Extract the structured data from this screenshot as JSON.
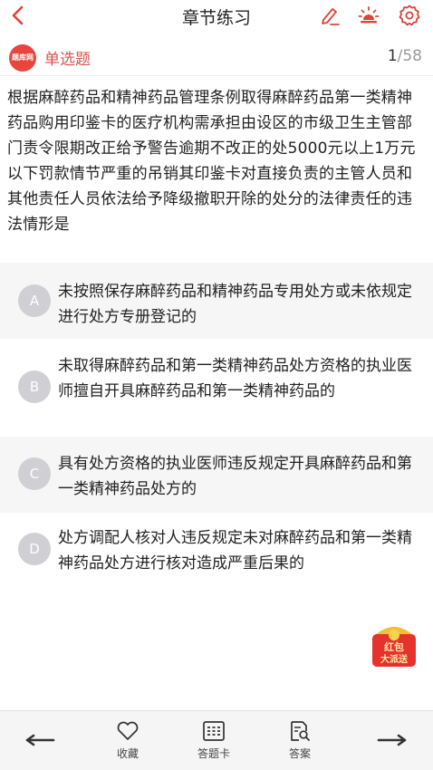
{
  "header": {
    "title": "章节练习",
    "icons": [
      "back-icon",
      "edit-icon",
      "night-mode-icon",
      "settings-icon"
    ]
  },
  "question_meta": {
    "brand_logo": "题库网",
    "type_label": "单选题",
    "current": "1",
    "total": "/58"
  },
  "question": {
    "text": "根据麻醉药品和精神药品管理条例取得麻醉药品第一类精神药品购用印鉴卡的医疗机构需承担由设区的市级卫生主管部门责令限期改正给予警告逾期不改正的处5000元以上1万元以下罚款情节严重的吊销其印鉴卡对直接负责的主管人员和其他责任人员依法给予降级撤职开除的处分的法律责任的违法情形是"
  },
  "options": [
    {
      "letter": "A",
      "text": "未按照保存麻醉药品和精神药品专用处方或未依规定进行处方专册登记的"
    },
    {
      "letter": "B",
      "text": "未取得麻醉药品和第一类精神药品处方资格的执业医师擅自开具麻醉药品和第一类精神药品的"
    },
    {
      "letter": "C",
      "text": "具有处方资格的执业医师违反规定开具麻醉药品和第一类精神药品处方的"
    },
    {
      "letter": "D",
      "text": "处方调配人核对人违反规定未对麻醉药品和第一类精神药品处方进行核对造成严重后果的"
    }
  ],
  "promo": {
    "line1": "红包",
    "line2": "大派送"
  },
  "toolbar": {
    "favorite_label": "收藏",
    "answer_card_label": "答题卡",
    "answer_label": "答案"
  },
  "colors": {
    "accent_red": "#d9534f",
    "option_badge": "#cfcfd4",
    "option_shade": "#f6f6f6"
  }
}
